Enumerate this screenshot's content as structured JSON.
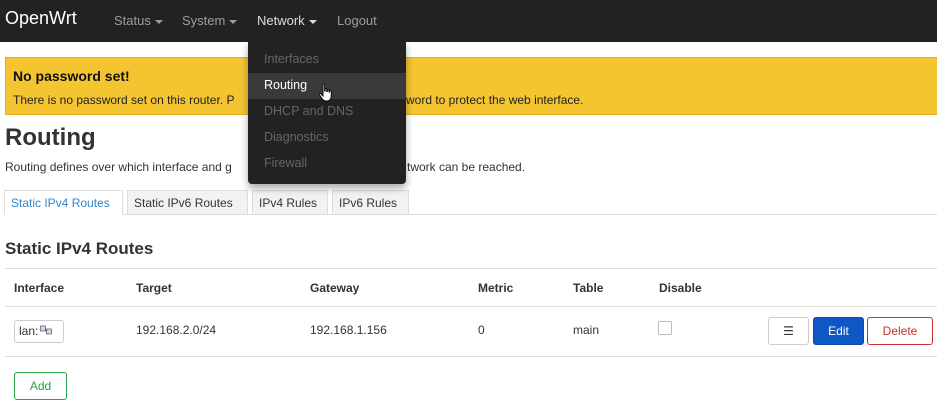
{
  "navbar": {
    "brand": "OpenWrt",
    "menu": [
      {
        "label": "Status",
        "has_dropdown": true
      },
      {
        "label": "System",
        "has_dropdown": true
      },
      {
        "label": "Network",
        "has_dropdown": true
      },
      {
        "label": "Logout",
        "has_dropdown": false
      }
    ]
  },
  "network_dropdown": {
    "items": [
      {
        "label": "Interfaces",
        "active": false
      },
      {
        "label": "Routing",
        "active": true
      },
      {
        "label": "DHCP and DNS",
        "active": false
      },
      {
        "label": "Diagnostics",
        "active": false
      },
      {
        "label": "Firewall",
        "active": false
      }
    ]
  },
  "alert": {
    "title": "No password set!",
    "text_left": "There is no password set on this router. P",
    "text_right": "word to protect the web interface."
  },
  "page": {
    "title": "Routing",
    "description_left": "Routing defines over which interface and g",
    "description_right": "twork can be reached."
  },
  "tabs": [
    {
      "label": "Static IPv4 Routes",
      "active": true
    },
    {
      "label": "Static IPv6 Routes",
      "active": false
    },
    {
      "label": "IPv4 Rules",
      "active": false
    },
    {
      "label": "IPv6 Rules",
      "active": false
    }
  ],
  "section": {
    "title": "Static IPv4 Routes"
  },
  "table": {
    "headers": [
      "Interface",
      "Target",
      "Gateway",
      "Metric",
      "Table",
      "Disable"
    ],
    "rows": [
      {
        "interface": "lan:",
        "target": "192.168.2.0/24",
        "gateway": "192.168.1.156",
        "metric": "0",
        "table": "main",
        "disabled": false
      }
    ]
  },
  "buttons": {
    "menu": "☰",
    "edit": "Edit",
    "delete": "Delete",
    "add": "Add"
  },
  "colors": {
    "navbar_bg": "#222222",
    "alert_bg": "#f4c531",
    "tab_active": "#3286ca",
    "edit_button": "#0f57c5",
    "delete_button": "#c9302c",
    "add_button": "#27a245"
  }
}
